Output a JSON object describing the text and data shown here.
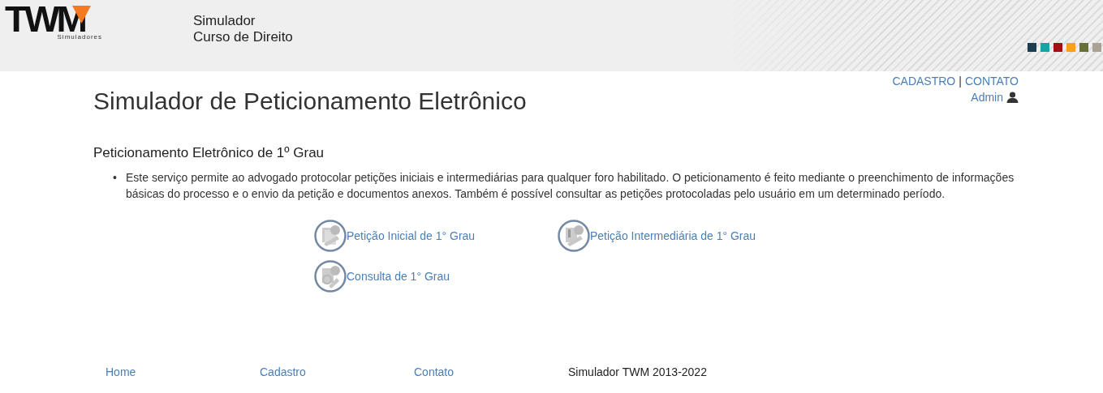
{
  "header": {
    "logo": {
      "text": "TWM",
      "subtitle": "Simuladores"
    },
    "title_lines": [
      "Simulador",
      "Curso de Direito"
    ],
    "swatches": [
      {
        "color": "#1d3e50"
      },
      {
        "color": "#17a2a4"
      },
      {
        "color": "#a30f13"
      },
      {
        "color": "#f7a11a"
      },
      {
        "color": "#667038"
      },
      {
        "color": "#a9a393"
      }
    ]
  },
  "top_links": {
    "links": [
      "CADASTRO",
      "CONTATO"
    ],
    "separator": "|",
    "user": "Admin"
  },
  "page_title": "Simulador de Peticionamento Eletrônico",
  "section": {
    "title": "Peticionamento Eletrônico de 1º Grau",
    "bullet_marker": "•",
    "bullets": [
      "Este serviço permite ao advogado protocolar petições iniciais e intermediárias para qualquer foro habilitado. O peticionamento é feito mediante o preenchimento de informações básicas do processo e o envio da petição e documentos anexos. Também é possível consultar as petições protocoladas pelo usuário em um determinado período."
    ],
    "actions": [
      {
        "label": "Petição Inicial de 1° Grau",
        "kind": "initial"
      },
      {
        "label": "Petição Intermediária de 1° Grau",
        "kind": "intermediate"
      },
      {
        "label": "Consulta de 1° Grau",
        "kind": "query"
      }
    ]
  },
  "footer": {
    "links": [
      "Home",
      "Cadastro",
      "Contato"
    ],
    "copyright": "Simulador TWM 2013-2022"
  }
}
